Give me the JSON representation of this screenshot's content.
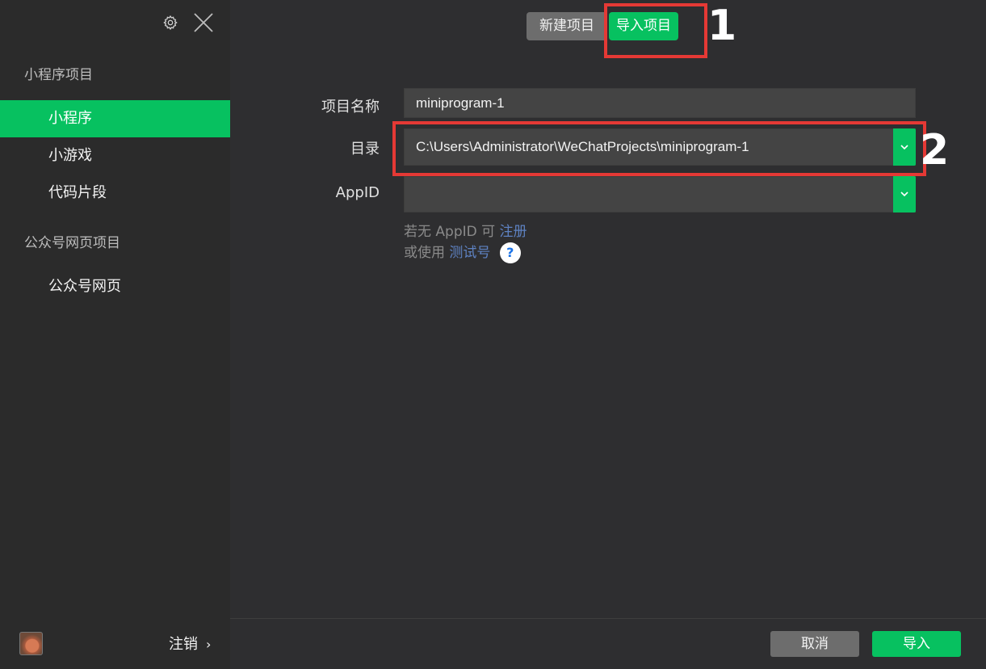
{
  "sidebar": {
    "section_miniprogram": "小程序项目",
    "items_miniprogram": [
      "小程序",
      "小游戏",
      "代码片段"
    ],
    "section_official": "公众号网页项目",
    "items_official": [
      "公众号网页"
    ],
    "logout_label": "注销",
    "logout_chevron": "›"
  },
  "tabs": {
    "new_project": "新建项目",
    "import_project": "导入项目"
  },
  "form": {
    "name_label": "项目名称",
    "name_value": "miniprogram-1",
    "dir_label": "目录",
    "dir_value": "C:\\Users\\Administrator\\WeChatProjects\\miniprogram-1",
    "appid_label": "AppID",
    "appid_value": "",
    "hint_line1_prefix": "若无 AppID 可",
    "hint_register_link": "注册",
    "hint_line2_prefix": "或使用",
    "hint_test_link": "测试号",
    "help_glyph": "?"
  },
  "footer": {
    "cancel_label": "取消",
    "import_label": "导入"
  },
  "annotations": {
    "marker_1": "1",
    "marker_2": "2"
  },
  "icons": {
    "settings": "gear-icon",
    "close": "close-icon",
    "dropdown": "chevron-down-icon"
  },
  "colors": {
    "accent": "#07c160",
    "annotation": "#e53935",
    "link": "#5e82c2"
  }
}
